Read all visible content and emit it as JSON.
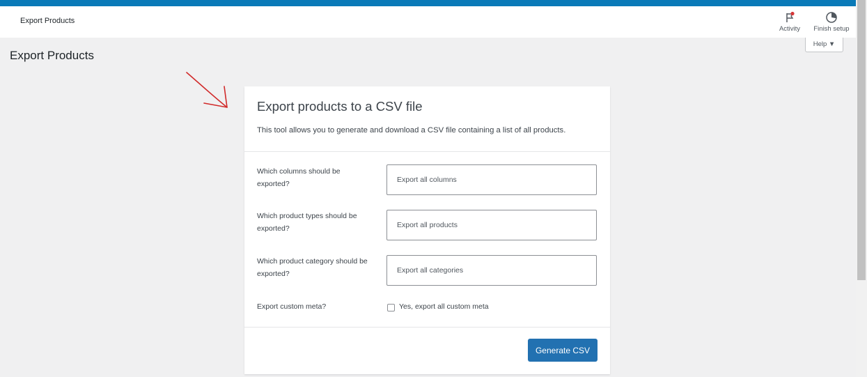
{
  "header": {
    "title": "Export Products",
    "activity_label": "Activity",
    "activity_icon": "flag-icon",
    "finish_setup_label": "Finish setup",
    "finish_setup_icon": "progress-circle-icon",
    "help_label": "Help ▼",
    "accent_color": "#0a7ab8"
  },
  "page": {
    "title": "Export Products"
  },
  "card": {
    "title": "Export products to a CSV file",
    "description": "This tool allows you to generate and download a CSV file containing a list of all products.",
    "fields": [
      {
        "label": "Which columns should be exported?",
        "value": "Export all columns"
      },
      {
        "label": "Which product types should be exported?",
        "value": "Export all products"
      },
      {
        "label": "Which product category should be exported?",
        "value": "Export all categories"
      }
    ],
    "custom_meta": {
      "label": "Export custom meta?",
      "checkbox_label": "Yes, export all custom meta",
      "checked": false
    },
    "submit_label": "Generate CSV",
    "button_color": "#2271b1"
  }
}
